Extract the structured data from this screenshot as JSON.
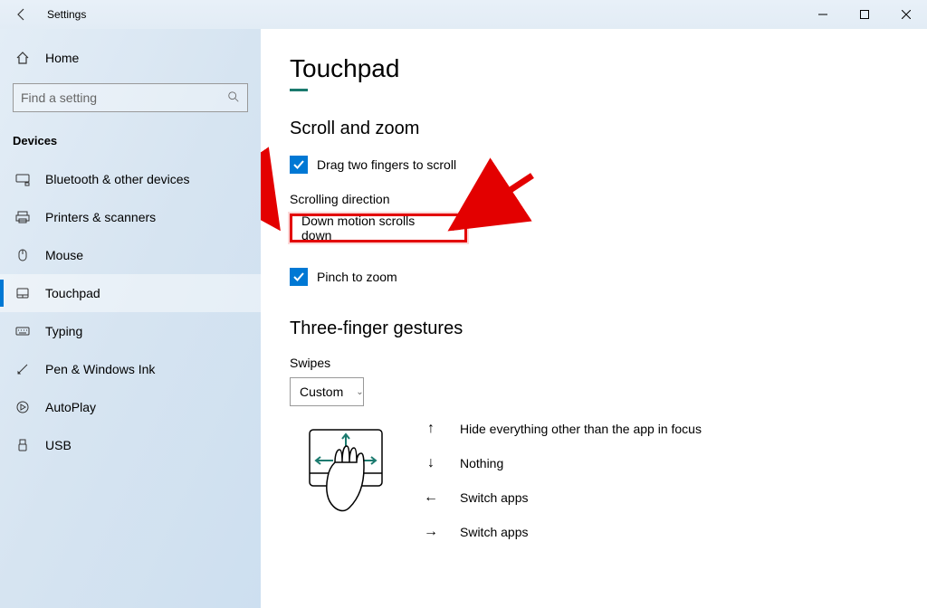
{
  "window": {
    "title": "Settings"
  },
  "sidebar": {
    "home": "Home",
    "search_placeholder": "Find a setting",
    "category": "Devices",
    "items": [
      {
        "label": "Bluetooth & other devices"
      },
      {
        "label": "Printers & scanners"
      },
      {
        "label": "Mouse"
      },
      {
        "label": "Touchpad"
      },
      {
        "label": "Typing"
      },
      {
        "label": "Pen & Windows Ink"
      },
      {
        "label": "AutoPlay"
      },
      {
        "label": "USB"
      }
    ]
  },
  "page": {
    "title": "Touchpad",
    "scroll_zoom": {
      "heading": "Scroll and zoom",
      "drag_label": "Drag two fingers to scroll",
      "scrolling_direction_label": "Scrolling direction",
      "scrolling_direction_value": "Down motion scrolls down",
      "pinch_label": "Pinch to zoom"
    },
    "three_finger": {
      "heading": "Three-finger gestures",
      "swipes_label": "Swipes",
      "swipes_value": "Custom",
      "gestures": [
        {
          "dir": "↑",
          "label": "Hide everything other than the app in focus"
        },
        {
          "dir": "↓",
          "label": "Nothing"
        },
        {
          "dir": "←",
          "label": "Switch apps"
        },
        {
          "dir": "→",
          "label": "Switch apps"
        }
      ]
    }
  }
}
